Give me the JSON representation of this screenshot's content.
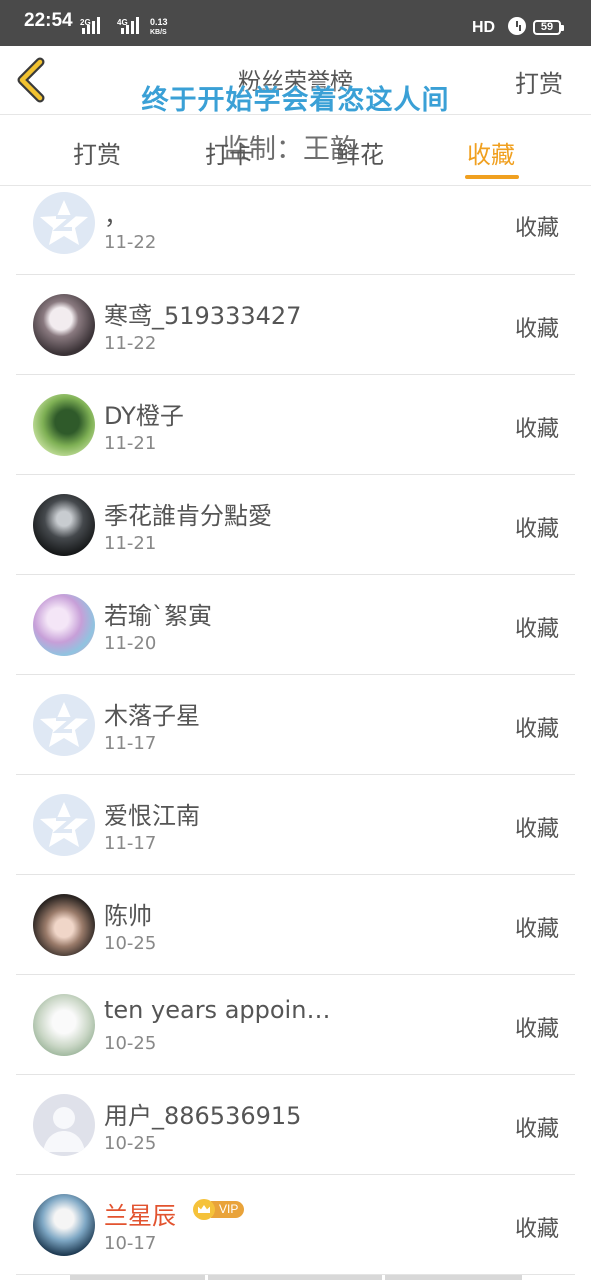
{
  "status_bar": {
    "time": "22:54",
    "net1": "2G",
    "net2": "4G",
    "speed_value": "0.13",
    "speed_unit": "KB/S",
    "hd": "HD",
    "battery": "59"
  },
  "header": {
    "title": "粉丝荣誉榜",
    "right_action": "打赏"
  },
  "overlay": {
    "lyric": "终于开始学会着恣这人间",
    "credit": "监制：王韵"
  },
  "tabs": [
    {
      "label": "打赏"
    },
    {
      "label": "打卡"
    },
    {
      "label": "鲜花"
    },
    {
      "label": "收藏",
      "active": true
    }
  ],
  "colors": {
    "accent": "#f0a020",
    "vip_name": "#e2532f",
    "overlay_text": "#3aa0d6"
  },
  "rows": [
    {
      "name": "，",
      "date": "11-22",
      "action": "收藏",
      "avatar": "default-qz-avatar"
    },
    {
      "name": "寒鸢_519333427",
      "date": "11-22",
      "action": "收藏",
      "avatar": "photo-avatar"
    },
    {
      "name": "DY橙子",
      "date": "11-21",
      "action": "收藏",
      "avatar": "photo-avatar"
    },
    {
      "name": "季花誰肯分點愛",
      "date": "11-21",
      "action": "收藏",
      "avatar": "photo-avatar"
    },
    {
      "name": "若瑜`絮寅",
      "date": "11-20",
      "action": "收藏",
      "avatar": "photo-avatar"
    },
    {
      "name": "木落子星",
      "date": "11-17",
      "action": "收藏",
      "avatar": "default-qz-avatar"
    },
    {
      "name": "爱恨江南",
      "date": "11-17",
      "action": "收藏",
      "avatar": "default-qz-avatar"
    },
    {
      "name": "陈帅",
      "date": "10-25",
      "action": "收藏",
      "avatar": "photo-avatar"
    },
    {
      "name": "ten years appoint...",
      "date": "10-25",
      "action": "收藏",
      "avatar": "photo-avatar"
    },
    {
      "name": "用户_886536915",
      "date": "10-25",
      "action": "收藏",
      "avatar": "default-person-avatar"
    },
    {
      "name": "兰星辰",
      "date": "10-17",
      "action": "收藏",
      "avatar": "photo-avatar",
      "vip": true,
      "vip_label": "VIP"
    }
  ]
}
